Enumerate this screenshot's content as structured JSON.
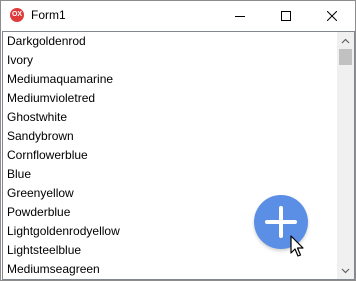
{
  "window": {
    "title": "Form1",
    "app_icon_text": "OX"
  },
  "titlebar_buttons": {
    "minimize": "minimize-icon",
    "maximize": "maximize-icon",
    "close": "close-icon"
  },
  "listbox": {
    "items": [
      "Darkgoldenrod",
      "Ivory",
      "Mediumaquamarine",
      "Mediumvioletred",
      "Ghostwhite",
      "Sandybrown",
      "Cornflowerblue",
      "Blue",
      "Greenyellow",
      "Powderblue",
      "Lightgoldenrodyellow",
      "Lightsteelblue",
      "Mediumseagreen"
    ]
  },
  "fab": {
    "icon": "plus-icon",
    "color": "#5b8fe6"
  },
  "colors": {
    "app_icon": "#e03b3b",
    "scrollbar_track": "#f0f0f0",
    "scrollbar_thumb": "#c1c1c1"
  }
}
